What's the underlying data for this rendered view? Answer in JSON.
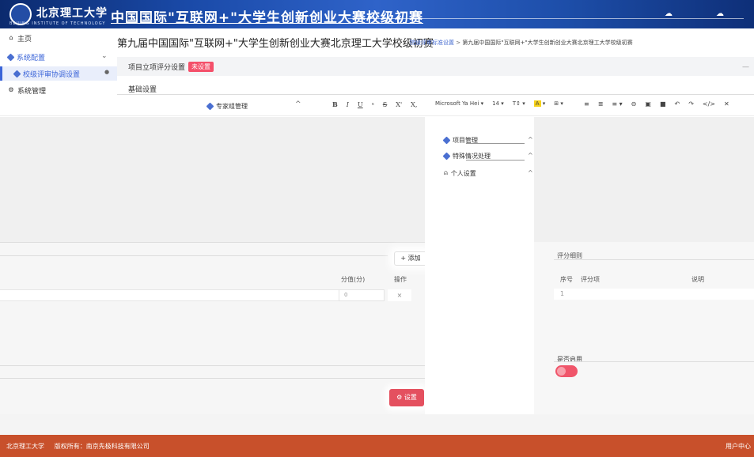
{
  "banner": {
    "logo_text": "北京理工大学",
    "logo_sub": "BEIJING INSTITUTE OF TECHNOLOGY",
    "title": "中国国际\"互联网+\"大学生创新创业大赛校级初赛",
    "bg": "#1a4aa8"
  },
  "sidebar": {
    "items": [
      {
        "icon": "home-icon",
        "label": "主页"
      },
      {
        "icon": "cube-icon",
        "label": "系统配置"
      },
      {
        "icon": "cube-icon",
        "label": "校级评审协调设置"
      },
      {
        "icon": "gear-icon",
        "label": "系统管理"
      }
    ],
    "accent": "#3a64d8"
  },
  "header": {
    "title": "第九届中国国际\"互联网+\"大学生创新创业大赛北京理工大学校级初赛",
    "breadcrumb": {
      "link": "院级评审标准设置",
      "sep": ">",
      "current": "第九届中国国际\"互联网+\"大学生创新创业大赛北京理工大学校级初赛"
    }
  },
  "setting_bar": {
    "label": "项目立项评分设置",
    "badge": "未设置",
    "badge_color": "#f4506a",
    "collapse": "—"
  },
  "subrow": {
    "label": "基础设置"
  },
  "toolbar": {
    "expert_label": "专家组管理",
    "expert_arrow": "^",
    "bold": "B",
    "italic": "I",
    "underline": "U",
    "strike_a": "ᵃ",
    "strike": "S",
    "superscript": "X'",
    "subscript": "X,",
    "font_family": "Microsoft Ya Hei ▾",
    "font_size": "14 ▾",
    "text_type": "T↕ ▾",
    "color_a": "A",
    "color_arrow": "▾",
    "table": "⊞ ▾",
    "list_ul": "≡",
    "list_ol": "≣",
    "align": "≡ ▾",
    "link": "⊖",
    "image": "▣",
    "video": "■",
    "undo": "↶",
    "redo": "↷",
    "code": "</>",
    "clear": "✕"
  },
  "dropdown": {
    "items": [
      {
        "icon": "cube-icon",
        "label": "项目管理",
        "arrow": "^"
      },
      {
        "icon": "cube-icon",
        "label": "特殊情况处理",
        "arrow": "^"
      },
      {
        "icon": "user-icon",
        "label": "个人设置",
        "arrow": "^"
      }
    ]
  },
  "score_table": {
    "add_label": "+ 添加",
    "col_score": "分值(分)",
    "col_op": "操作",
    "row_score": "0",
    "row_delete": "×",
    "set_label": "⚙ 设置",
    "set_color": "#e4505f"
  },
  "review": {
    "title": "评分细则",
    "col_index": "序号",
    "col_item": "评分项",
    "col_note": "说明",
    "row_index": "1",
    "switch_label": "是否启用",
    "switch_color": "#f0556a"
  },
  "footer": {
    "left_school": "北京理工大学",
    "left_copyright": "版权所有：南京先极科技有限公司",
    "right": "用户中心",
    "bg": "#c8502b"
  }
}
